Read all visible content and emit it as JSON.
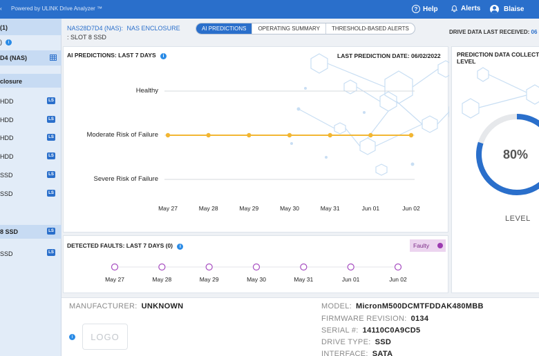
{
  "topbar": {
    "brand": "Powered by ULINK Drive Analyzer ™",
    "help": "Help",
    "alerts": "Alerts",
    "user": "Blaise"
  },
  "sidebar": {
    "items": [
      {
        "label": "(1)",
        "selected": true,
        "badge": ""
      },
      {
        "label": ")",
        "selected": false,
        "badge": "info"
      },
      {
        "label": "D4 (NAS)",
        "selected": true,
        "badge": "grid"
      },
      {
        "label": "closure",
        "selected": true,
        "badge": ""
      },
      {
        "label": "HDD",
        "selected": false,
        "badge": "LS"
      },
      {
        "label": "HDD",
        "selected": false,
        "badge": "LS"
      },
      {
        "label": "HDD",
        "selected": false,
        "badge": "LS"
      },
      {
        "label": "HDD",
        "selected": false,
        "badge": "LS"
      },
      {
        "label": "SSD",
        "selected": false,
        "badge": "LS"
      },
      {
        "label": "SSD",
        "selected": false,
        "badge": "LS"
      },
      {
        "label": "8 SSD",
        "selected": true,
        "badge": "LS"
      },
      {
        "label": "SSD",
        "selected": false,
        "badge": "LS"
      }
    ]
  },
  "breadcrumb": {
    "nas": "NAS28D7D4 (NAS):",
    "enclosure": "NAS ENCLOSURE",
    "slot": ": SLOT 8 SSD"
  },
  "tabs": [
    "AI PREDICTIONS",
    "OPERATING SUMMARY",
    "THRESHOLD-BASED ALERTS"
  ],
  "active_tab": 0,
  "drive_received": {
    "label": "DRIVE DATA LAST RECEIVED:",
    "value": "06"
  },
  "ai_card": {
    "title": "AI PREDICTIONS: LAST 7 DAYS",
    "last_prediction": "LAST PREDICTION DATE: 06/02/2022"
  },
  "faults_card": {
    "title": "DETECTED FAULTS: LAST 7 DAYS (0)",
    "legend": "Faulty",
    "dates": [
      "May 27",
      "May 28",
      "May 29",
      "May 30",
      "May 31",
      "Jun 01",
      "Jun 02"
    ]
  },
  "collection_card": {
    "title_line1": "PREDICTION DATA COLLECTI",
    "title_line2": "LEVEL",
    "percent": "80%",
    "value": 80,
    "level_label": "LEVEL"
  },
  "chart_data": {
    "type": "line",
    "title": "AI PREDICTIONS: LAST 7 DAYS",
    "categories": [
      "May 27",
      "May 28",
      "May 29",
      "May 30",
      "May 31",
      "Jun 01",
      "Jun 02"
    ],
    "y_categories": [
      "Healthy",
      "Moderate Risk of Failure",
      "Severe Risk of Failure"
    ],
    "series": [
      {
        "values": [
          "Moderate Risk of Failure",
          "Moderate Risk of Failure",
          "Moderate Risk of Failure",
          "Moderate Risk of Failure",
          "Moderate Risk of Failure",
          "Moderate Risk of Failure",
          "Moderate Risk of Failure"
        ],
        "color": "#f2b632"
      }
    ],
    "grid": true
  },
  "details": {
    "manufacturer_label": "MANUFACTURER:",
    "manufacturer": "UNKNOWN",
    "logo": "LOGO",
    "model_label": "MODEL:",
    "model": "MicronM500DCMTFDDAK480MBB",
    "firmware_label": "FIRMWARE REVISION:",
    "firmware": "0134",
    "serial_label": "SERIAL #:",
    "serial": "14110C0A9CD5",
    "drive_type_label": "DRIVE TYPE:",
    "drive_type": "SSD",
    "interface_label": "INTERFACE:",
    "interface": "SATA"
  },
  "colors": {
    "brand": "#2a6fcb",
    "risk_line": "#f2b632",
    "faulty": "#9c3bb0",
    "sidebar_bg": "#e2ecf8"
  }
}
